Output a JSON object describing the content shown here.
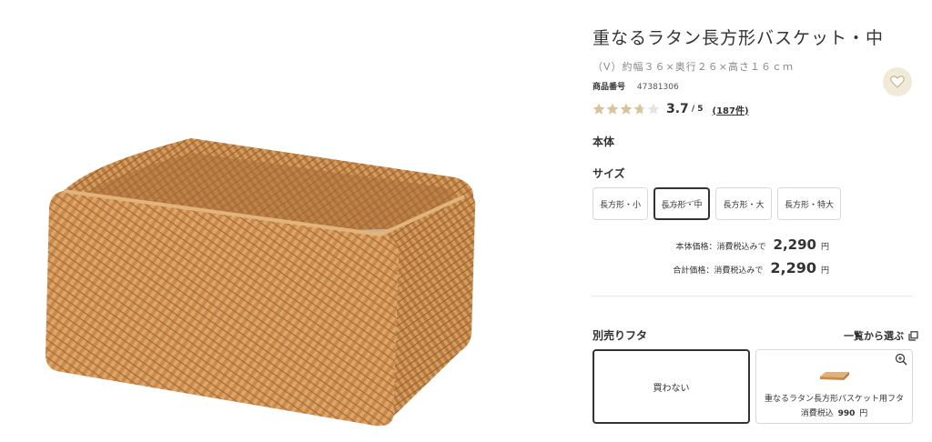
{
  "product": {
    "title": "重なるラタン長方形バスケット・中",
    "spec": "（V）約幅３６×奥行２６×高さ１６ｃｍ",
    "code_label": "商品番号",
    "code_value": "47381306",
    "rating": {
      "stars_filled": 3.7,
      "stars_total": 5,
      "value": "3.7",
      "max": "/ 5",
      "count": "(187件)"
    }
  },
  "sections": {
    "body_label": "本体",
    "size_label": "サイズ"
  },
  "size_options": [
    {
      "label": "長方形・小",
      "selected": false
    },
    {
      "label": "長方形・中",
      "selected": true
    },
    {
      "label": "長方形・大",
      "selected": false
    },
    {
      "label": "長方形・特大",
      "selected": false
    }
  ],
  "prices": {
    "base_label": "本体価格：消費税込みで",
    "base_value": "2,290",
    "total_label": "合計価格：消費税込みで",
    "total_value": "2,290",
    "yen": "円"
  },
  "lid": {
    "label": "別売りフタ",
    "select_all": "一覧から選ぶ",
    "none_label": "買わない",
    "item_name": "重なるラタン長方形バスケット用フタ",
    "item_price_prefix": "消費税込",
    "item_price_value": "990",
    "item_price_yen": "円"
  },
  "colors": {
    "star_filled": "#d8c49c",
    "star_empty": "#e4e4e4",
    "fav_bg": "#f2ead9",
    "rattan": "#c98a4b"
  },
  "icons": {
    "favorite": "heart-icon",
    "select_list": "copy-icon",
    "zoom": "zoom-in-icon"
  }
}
